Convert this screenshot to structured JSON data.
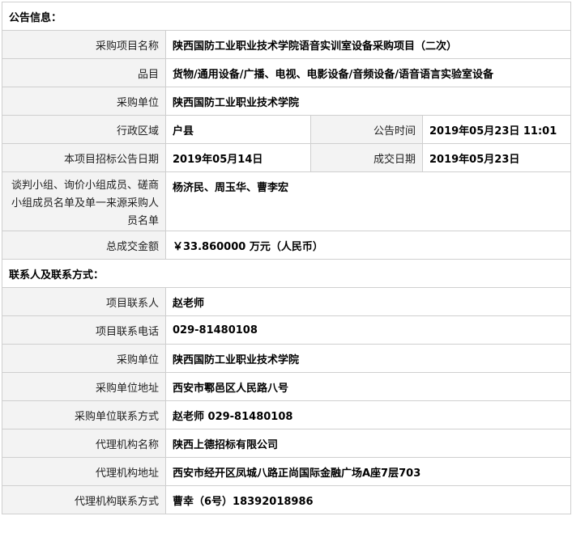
{
  "notice": {
    "section_title": "公告信息：",
    "rows": {
      "project_name": {
        "label": "采购项目名称",
        "value": "陕西国防工业职业技术学院语音实训室设备采购项目（二次）"
      },
      "category": {
        "label": "品目",
        "value": "货物/通用设备/广播、电视、电影设备/音频设备/语音语言实验室设备"
      },
      "purchaser": {
        "label": "采购单位",
        "value": "陕西国防工业职业技术学院"
      },
      "region": {
        "label": "行政区域",
        "value": "户县"
      },
      "announce_time": {
        "label": "公告时间",
        "value": "2019年05月23日 11:01"
      },
      "tender_date": {
        "label": "本项目招标公告日期",
        "value": "2019年05月14日"
      },
      "deal_date": {
        "label": "成交日期",
        "value": "2019年05月23日"
      },
      "panel_members": {
        "label": "谈判小组、询价小组成员、磋商小组成员名单及单一来源采购人员名单",
        "value": "杨济民、周玉华、曹李宏"
      },
      "total_amount": {
        "label": "总成交金额",
        "value": "￥33.860000 万元（人民币）"
      }
    }
  },
  "contact": {
    "section_title": "联系人及联系方式：",
    "rows": {
      "project_contact": {
        "label": "项目联系人",
        "value": "赵老师"
      },
      "project_phone": {
        "label": "项目联系电话",
        "value": "029-81480108"
      },
      "purchaser": {
        "label": "采购单位",
        "value": "陕西国防工业职业技术学院"
      },
      "purchaser_address": {
        "label": "采购单位地址",
        "value": "西安市鄠邑区人民路八号"
      },
      "purchaser_contact": {
        "label": "采购单位联系方式",
        "value": "赵老师 029-81480108"
      },
      "agency_name": {
        "label": "代理机构名称",
        "value": "陕西上德招标有限公司"
      },
      "agency_address": {
        "label": "代理机构地址",
        "value": "西安市经开区凤城八路正尚国际金融广场A座7层703"
      },
      "agency_contact": {
        "label": "代理机构联系方式",
        "value": "曹幸（6号）18392018986"
      }
    }
  }
}
